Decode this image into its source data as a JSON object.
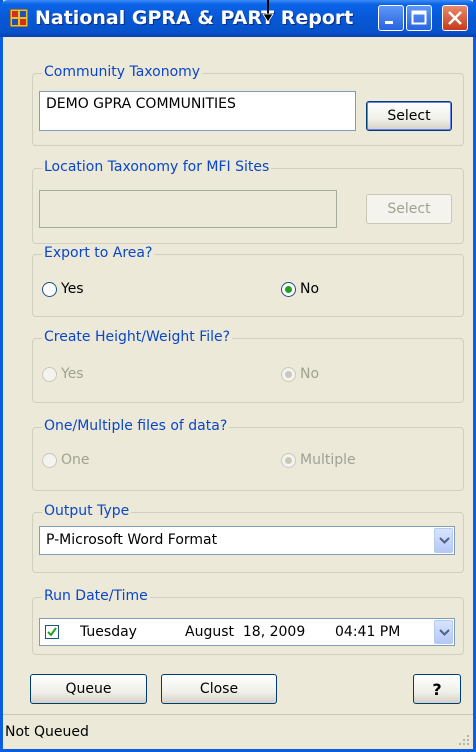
{
  "window": {
    "title": "National GPRA & PART Report"
  },
  "community_taxonomy": {
    "legend": "Community Taxonomy",
    "value": "DEMO GPRA COMMUNITIES",
    "select_label": "Select"
  },
  "location_taxonomy": {
    "legend": "Location Taxonomy for MFI Sites",
    "value": "",
    "select_label": "Select"
  },
  "export_area": {
    "legend": "Export to Area?",
    "yes_label": "Yes",
    "no_label": "No",
    "selected": "No"
  },
  "height_weight": {
    "legend": "Create Height/Weight File?",
    "yes_label": "Yes",
    "no_label": "No",
    "selected": "No"
  },
  "files": {
    "legend": "One/Multiple files of data?",
    "one_label": "One",
    "multiple_label": "Multiple",
    "selected": "Multiple"
  },
  "output_type": {
    "legend": "Output Type",
    "value": "P-Microsoft Word Format"
  },
  "run_datetime": {
    "legend": "Run Date/Time",
    "checked": true,
    "weekday": "Tuesday",
    "date": "August  18, 2009",
    "time": "04:41 PM"
  },
  "buttons": {
    "queue_label": "Queue",
    "close_label": "Close",
    "help_label": "?"
  },
  "status": {
    "text": "Not Queued"
  },
  "colors": {
    "titlebar": "#0757d6",
    "frame": "#0a5fe0",
    "legend_text": "#0a46c8",
    "radio_dot": "#21a121",
    "background": "#ece9d8"
  }
}
